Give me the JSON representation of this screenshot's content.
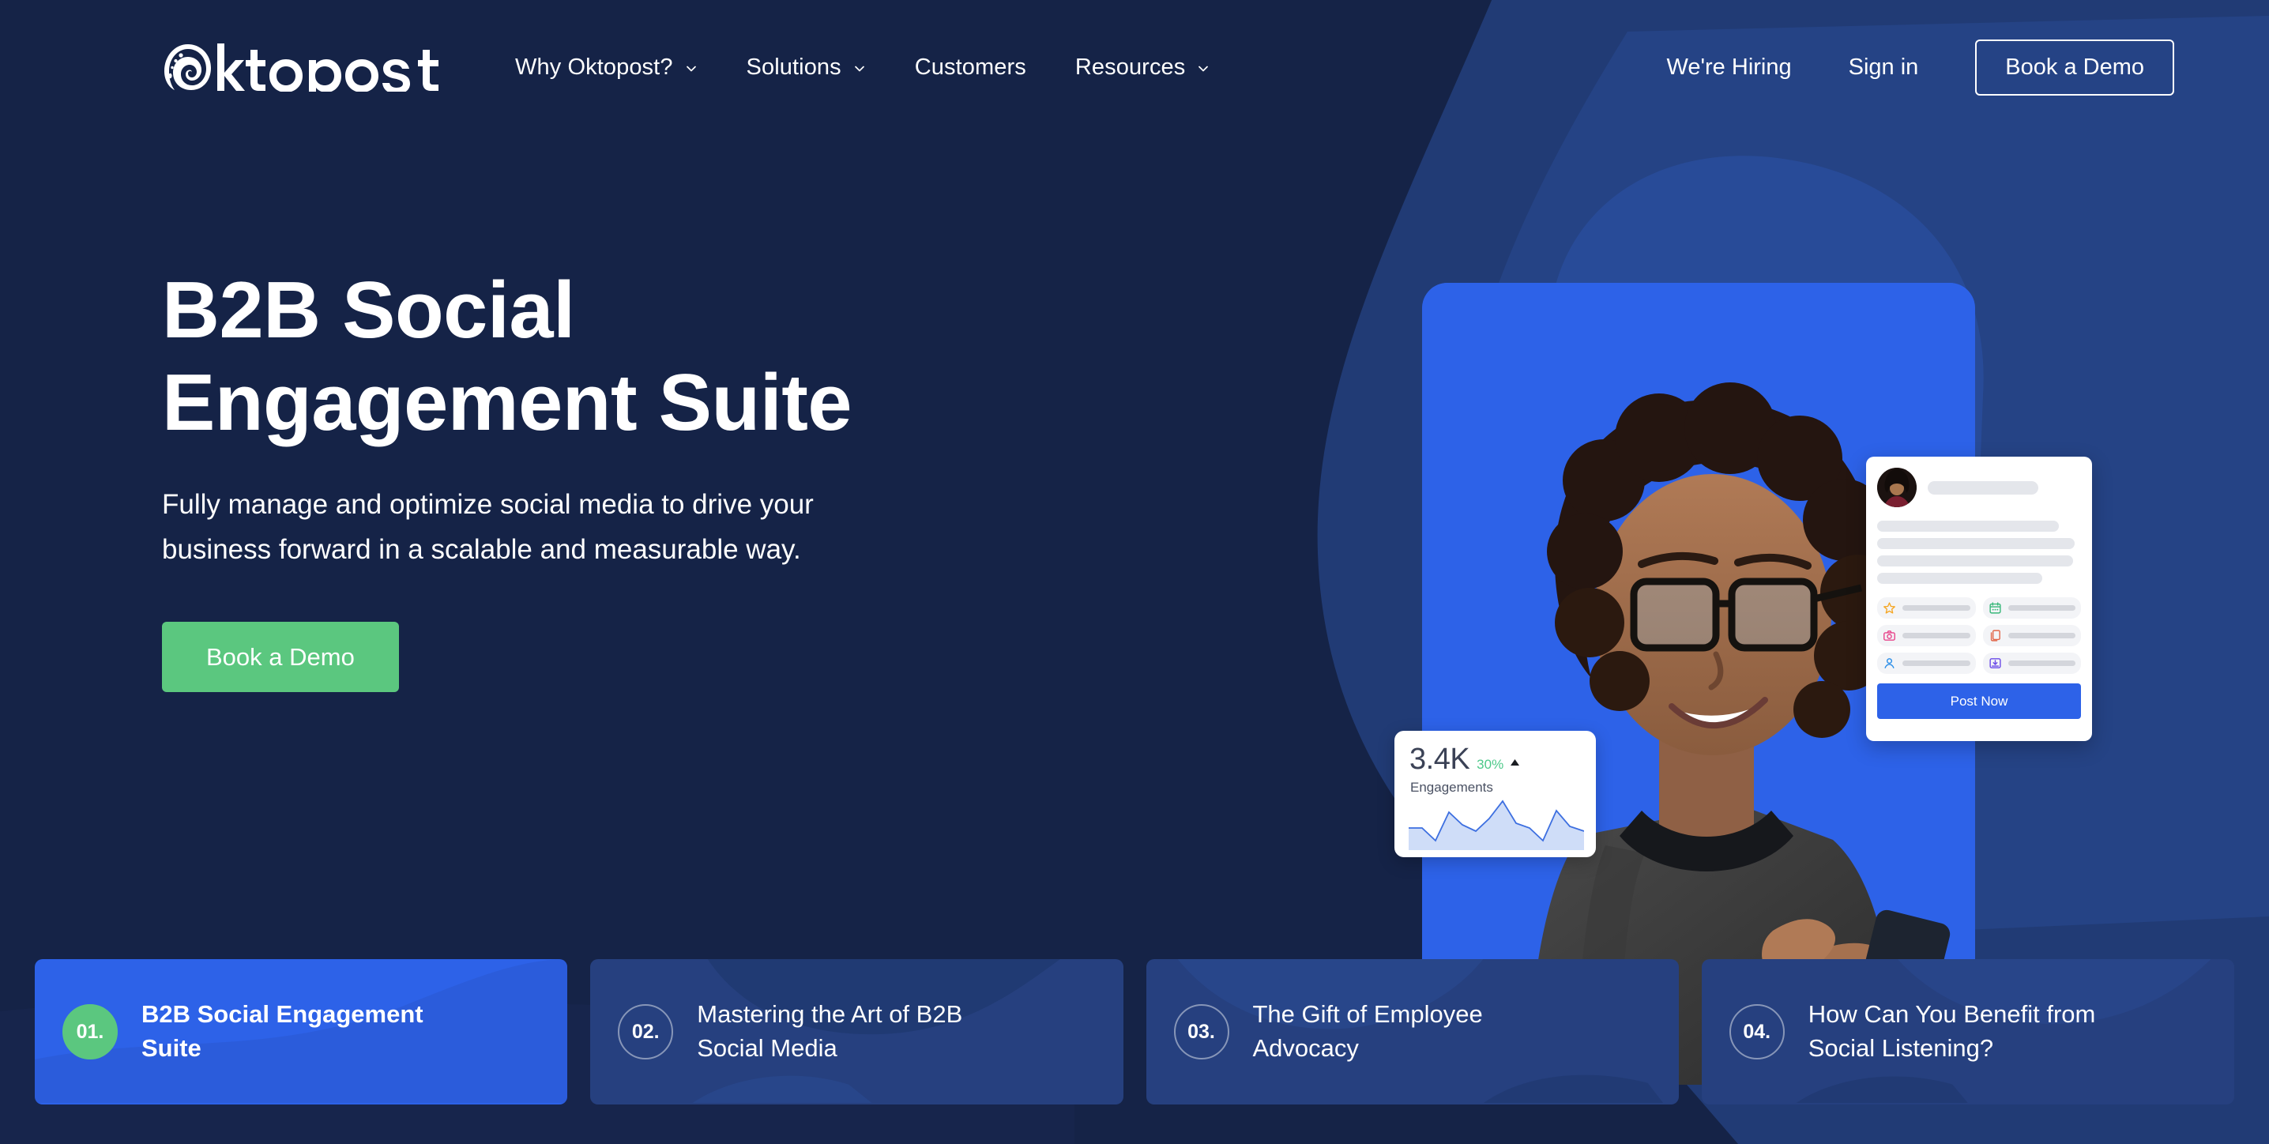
{
  "brand": {
    "logo_text": "Oktopost",
    "navy": "#152347",
    "blue": "#2D62E8",
    "card_blue": "#26407F",
    "green": "#5BC77F",
    "white": "#FFFFFF"
  },
  "header": {
    "nav_items": [
      {
        "label": "Why Oktopost?",
        "has_dropdown": true,
        "icon": "chevron-down-icon"
      },
      {
        "label": "Solutions",
        "has_dropdown": true,
        "icon": "chevron-down-icon"
      },
      {
        "label": "Customers",
        "has_dropdown": false,
        "icon": ""
      },
      {
        "label": "Resources",
        "has_dropdown": true,
        "icon": "chevron-down-icon"
      }
    ],
    "hiring_label": "We're Hiring",
    "signin_label": "Sign in",
    "demo_label": "Book a Demo"
  },
  "hero": {
    "title": "B2B Social\nEngagement Suite",
    "subtitle": "Fully manage and optimize social media to drive your\nbusiness forward in a scalable and measurable way.",
    "cta_label": "Book a Demo"
  },
  "stat_card": {
    "value": "3.4K",
    "delta": "30%",
    "trend_icon": "caret-up-icon",
    "label": "Engagements"
  },
  "post_card": {
    "avatar_icon": "user-avatar-photo",
    "post_button_label": "Post Now",
    "chips": [
      {
        "icon": "star-icon",
        "color": "#F5A623"
      },
      {
        "icon": "calendar-icon",
        "color": "#39B87A"
      },
      {
        "icon": "camera-icon",
        "color": "#E8468C"
      },
      {
        "icon": "copy-icon",
        "color": "#E2674A"
      },
      {
        "icon": "person-icon",
        "color": "#2D8FE8"
      },
      {
        "icon": "image-download-icon",
        "color": "#6B4BE8"
      }
    ]
  },
  "bottom_cards": [
    {
      "number": "01.",
      "title": "B2B Social Engagement\nSuite",
      "active": true
    },
    {
      "number": "02.",
      "title": "Mastering the Art of B2B\nSocial Media",
      "active": false
    },
    {
      "number": "03.",
      "title": "The Gift of Employee\nAdvocacy",
      "active": false
    },
    {
      "number": "04.",
      "title": "How Can You Benefit from\nSocial Listening?",
      "active": false
    }
  ],
  "chart_data": {
    "type": "area",
    "title": "Engagements",
    "annotations": [
      "3.4K",
      "30%"
    ],
    "x": [
      0,
      1,
      2,
      3,
      4,
      5,
      6,
      7,
      8,
      9,
      10,
      11,
      12
    ],
    "values": [
      30,
      30,
      12,
      52,
      37,
      29,
      46,
      72,
      43,
      36,
      12,
      55,
      33,
      28
    ],
    "ylim": [
      0,
      80
    ],
    "grid": false,
    "legend": "none",
    "line_color": "#3D6FE0",
    "fill_color": "#CFDDF8"
  }
}
